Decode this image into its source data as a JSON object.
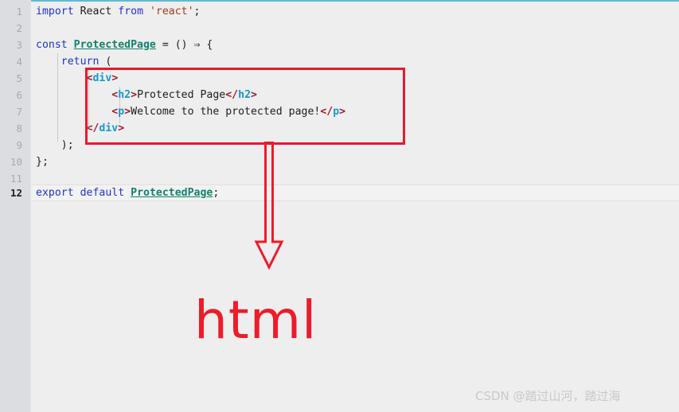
{
  "editor": {
    "background_color": "#eeeeee",
    "gutter_color": "#dcdde1",
    "top_rule_color": "#62b8d4",
    "active_line_number": "12",
    "line_numbers": [
      "1",
      "2",
      "3",
      "4",
      "5",
      "6",
      "7",
      "8",
      "9",
      "10",
      "11",
      "12"
    ],
    "lines": [
      {
        "n": "1",
        "text": "import React from 'react';"
      },
      {
        "n": "2",
        "text": ""
      },
      {
        "n": "3",
        "text": "const ProtectedPage = () ⇒ {"
      },
      {
        "n": "4",
        "text": "    return ("
      },
      {
        "n": "5",
        "text": "        <div>"
      },
      {
        "n": "6",
        "text": "            <h2>Protected Page</h2>"
      },
      {
        "n": "7",
        "text": "            <p>Welcome to the protected page!</p>"
      },
      {
        "n": "8",
        "text": "        </div>"
      },
      {
        "n": "9",
        "text": "    );"
      },
      {
        "n": "10",
        "text": "};"
      },
      {
        "n": "11",
        "text": ""
      },
      {
        "n": "12",
        "text": "export default ProtectedPage;"
      }
    ],
    "tokens": {
      "kw_import": "import",
      "ident_react": "React",
      "kw_from": "from",
      "str_react": "'react'",
      "semi": ";",
      "kw_const": "const",
      "name_protectedpage": "ProtectedPage",
      "eq": " = () ",
      "arrow_fn": "⇒",
      "brace_open": " {",
      "kw_return": "return",
      "paren_open": " (",
      "lt": "<",
      "gt": ">",
      "lt_slash": "</",
      "tag_div": "div",
      "tag_h2": "h2",
      "tag_p": "p",
      "text_protected_page": "Protected Page",
      "text_welcome": "Welcome to the protected page!",
      "paren_close_semi": ");",
      "brace_close_semi": "};",
      "kw_export": "export",
      "kw_default": "default"
    },
    "colors": {
      "keyword": "#2033c8",
      "string": "#9c3b1b",
      "function_name": "#11826b",
      "tag_bracket": "#a3192c",
      "tag_name": "#129ad1",
      "plain_text": "#1d1d1d",
      "line_number": "#a7a9ae"
    }
  },
  "annotation": {
    "box_color": "#e8192c",
    "arrow_color": "#ee1b2a",
    "label": "html",
    "label_color": "#ee1b2a"
  },
  "watermark": {
    "text": "CSDN @踏过山河，踏过海",
    "color": "#c9c9c9"
  }
}
